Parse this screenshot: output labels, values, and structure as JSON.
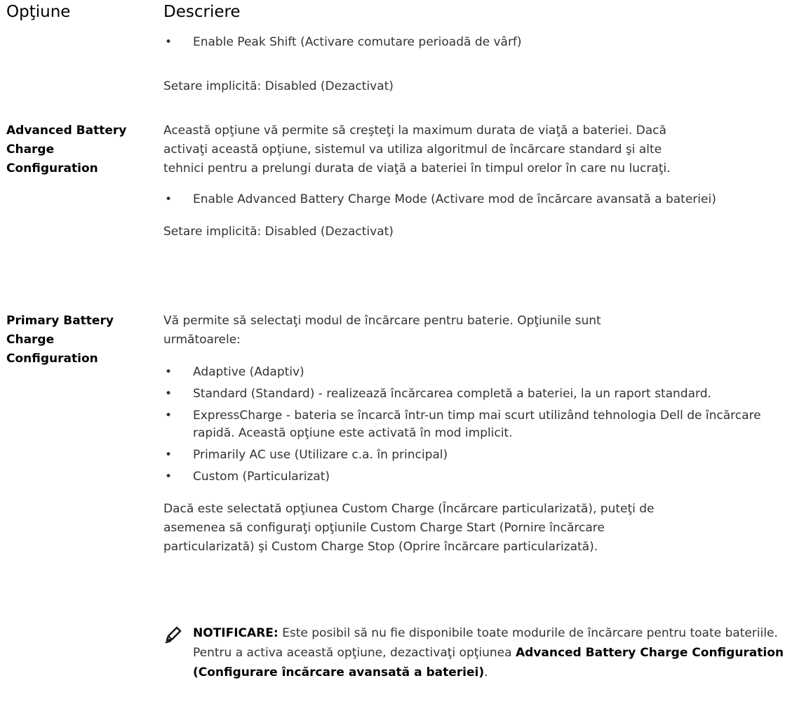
{
  "header": {
    "option": "Opţiune",
    "description": "Descriere"
  },
  "rows": [
    {
      "bullets": [
        "Enable Peak Shift (Activare comutare perioadă de vârf)"
      ],
      "default": "Setare implicită: Disabled (Dezactivat)"
    },
    {
      "name_lines": [
        "Advanced Battery",
        "Charge",
        "Configuration"
      ],
      "intro_lines": [
        "Această opţiune vă permite să creşteţi la maximum durata de viaţă a bateriei. Dacă",
        "activaţi această opţiune, sistemul va utiliza algoritmul de încărcare standard şi alte",
        "tehnici pentru a prelungi durata de viaţă a bateriei în timpul orelor în care nu lucraţi."
      ],
      "bullets": [
        "Enable Advanced Battery Charge Mode (Activare mod de încărcare avansată a bateriei)"
      ],
      "default": "Setare implicită: Disabled (Dezactivat)"
    },
    {
      "name_lines": [
        "Primary Battery",
        "Charge",
        "Configuration"
      ],
      "intro_lines": [
        "Vă permite să selectaţi modul de încărcare pentru baterie. Opţiunile sunt",
        "următoarele:"
      ],
      "bullets": [
        "Adaptive (Adaptiv)",
        "Standard (Standard) - realizează încărcarea completă a bateriei, la un raport standard.",
        "ExpressCharge - bateria se încarcă într-un timp mai scurt utilizând tehnologia Dell de încărcare rapidă. Această opţiune este activată în mod implicit.",
        "Primarily AC use (Utilizare c.a. în principal)",
        "Custom (Particularizat)"
      ],
      "extra_lines": [
        "Dacă este selectată opţiunea Custom Charge (Încărcare particularizată), puteţi de",
        "asemenea să configuraţi opţiunile Custom Charge Start (Pornire încărcare",
        "particularizată) şi Custom Charge Stop (Oprire încărcare particularizată)."
      ],
      "note": {
        "icon": "pencil-note-icon",
        "label": "NOTIFICARE:",
        "text": " Este posibil să nu fie disponibile toate modurile de încărcare pentru toate bateriile. Pentru a activa această opţiune, dezactivaţi opţiunea ",
        "bold": "Advanced Battery Charge Configuration (Configurare încărcare avansată a bateriei)",
        "end": "."
      }
    }
  ]
}
